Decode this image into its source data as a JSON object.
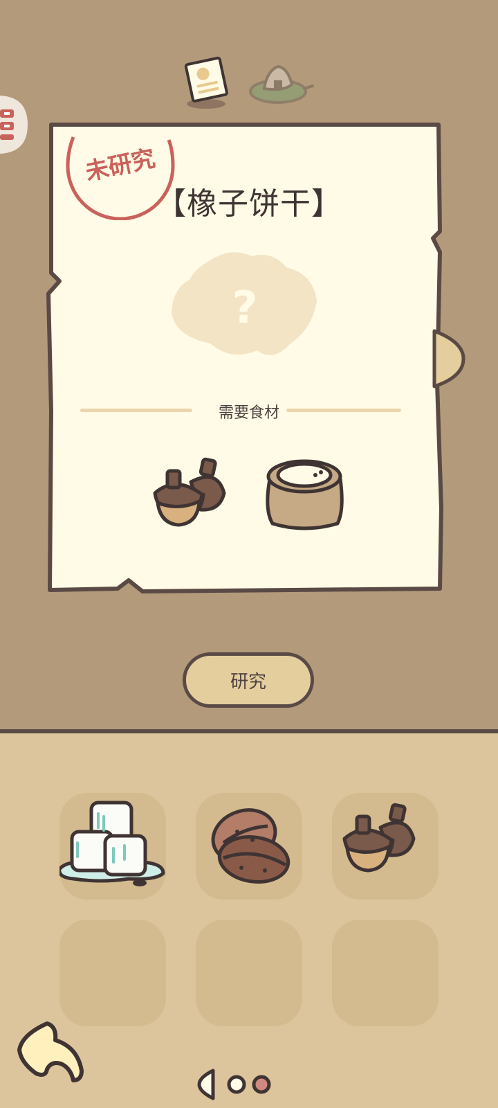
{
  "recipe": {
    "title": "【橡子饼干】",
    "status_stamp": "未研究",
    "image_placeholder": "?",
    "ingredients_label": "需要食材",
    "ingredients": [
      "acorn-icon",
      "flour-sack-icon"
    ]
  },
  "actions": {
    "research_label": "研究"
  },
  "top_tabs": [
    "recipe-card-icon",
    "onigiri-plate-icon"
  ],
  "inventory": {
    "items": [
      "ice-cubes-icon",
      "coffee-bean-icon",
      "acorn-icon",
      "",
      "",
      ""
    ]
  },
  "pagination": {
    "dots": [
      "page-dot-1",
      "page-dot-2"
    ],
    "active_index": 1
  },
  "colors": {
    "background_top": "#b39a7b",
    "background_bottom": "#dcc59c",
    "paper": "#fffbe6",
    "outline": "#5a4a45",
    "stamp_red": "#c9625a",
    "button_fill": "#e5ce9e"
  }
}
